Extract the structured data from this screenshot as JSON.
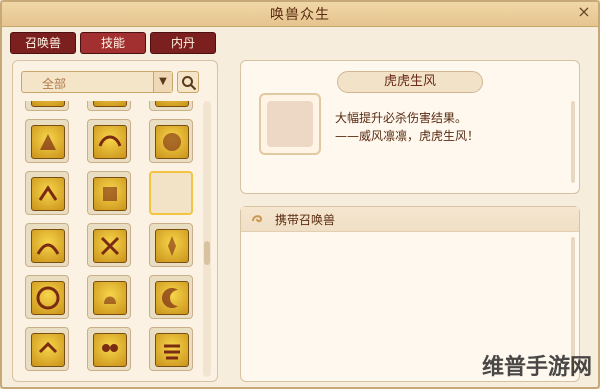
{
  "window": {
    "title": "唤兽众生",
    "close_glyph": "×"
  },
  "tabs": [
    {
      "label": "召唤兽",
      "active": false
    },
    {
      "label": "技能",
      "active": true
    },
    {
      "label": "内丹",
      "active": false
    }
  ],
  "filter": {
    "selected": "全部"
  },
  "skill_detail": {
    "name": "虎虎生风",
    "desc_line1": "大幅提升必杀伤害结果。",
    "desc_line2": "——威风凛凛，虎虎生风！"
  },
  "section": {
    "title": "携带召唤兽"
  },
  "watermark": "维普手游网",
  "colors": {
    "tab_bg": "#7c1f1f",
    "tab_active": "#a33030",
    "gold": "#f2c441"
  }
}
